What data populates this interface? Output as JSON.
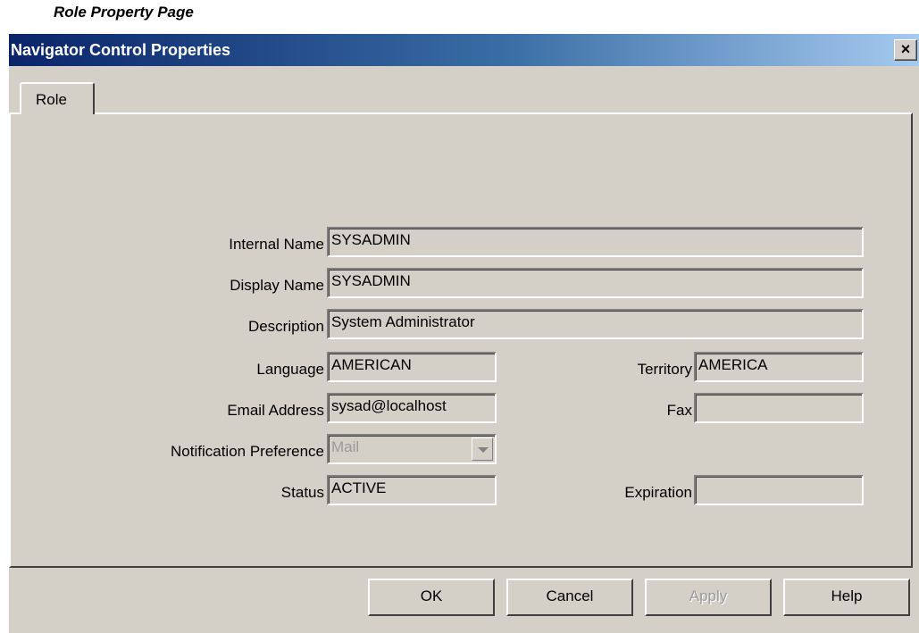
{
  "caption": "Role Property Page",
  "window": {
    "title": "Navigator Control Properties",
    "close_glyph": "×"
  },
  "tabs": [
    {
      "label": "Role",
      "selected": true
    }
  ],
  "form": {
    "internal_name": {
      "label": "Internal Name",
      "value": "SYSADMIN"
    },
    "display_name": {
      "label": "Display Name",
      "value": "SYSADMIN"
    },
    "description": {
      "label": "Description",
      "value": "System Administrator"
    },
    "language": {
      "label": "Language",
      "value": "AMERICAN"
    },
    "territory": {
      "label": "Territory",
      "value": "AMERICA"
    },
    "email": {
      "label": "Email Address",
      "value": "sysad@localhost"
    },
    "fax": {
      "label": "Fax",
      "value": ""
    },
    "notification": {
      "label": "Notification Preference",
      "value": "Mail",
      "disabled": true
    },
    "status": {
      "label": "Status",
      "value": "ACTIVE"
    },
    "expiration": {
      "label": "Expiration",
      "value": ""
    }
  },
  "buttons": {
    "ok": "OK",
    "cancel": "Cancel",
    "apply": "Apply",
    "help": "Help"
  },
  "icons": {
    "close": "close-icon",
    "dropdown": "chevron-down-icon"
  },
  "colors": {
    "titlebar_start": "#0a246a",
    "titlebar_end": "#a6caf0",
    "face": "#d4d0c8"
  }
}
